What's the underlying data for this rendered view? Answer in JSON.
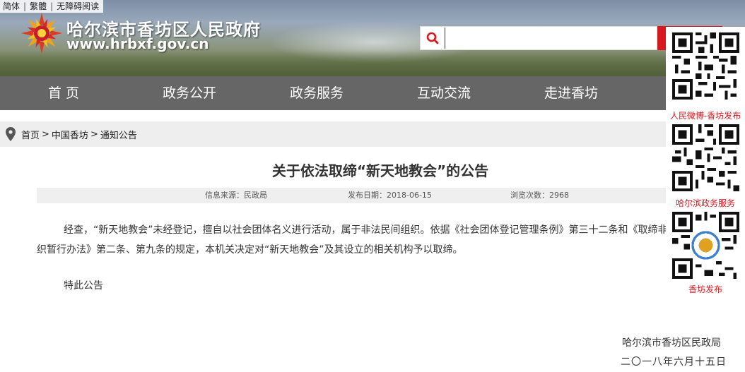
{
  "lang_bar": {
    "simplified": "简体",
    "traditional": "繁體",
    "accessibility": "无障碍阅读"
  },
  "site": {
    "title": "哈尔滨市香坊区人民政府",
    "url": "www.hrbxf.gov.cn"
  },
  "search": {
    "value": "",
    "placeholder": ""
  },
  "nav": {
    "items": [
      "首 页",
      "政务公开",
      "政务服务",
      "互动交流",
      "走进香坊"
    ]
  },
  "breadcrumb": {
    "home": "首页",
    "level1": "中国香坊",
    "current": "通知公告"
  },
  "article": {
    "title": "关于依法取缔“新天地教会”的公告",
    "source_label": "信息来源：",
    "source": "民政局",
    "date_label": "发布日期：",
    "date": "2018-06-15",
    "views_label": "浏览次数：",
    "views": "2968",
    "body": "经查，“新天地教会”未经登记，擅自以社会团体名义进行活动，属于非法民间组织。依据《社会团体登记管理条例》第三十二条和《取缔非法民间组织暂行办法》第二条、第九条的规定，本机关决定对“新天地教会”及其设立的相关机构予以取缔。",
    "note": "特此公告",
    "signer": "哈尔滨市香坊区民政局",
    "sign_date": "二〇一八年六月十五日"
  },
  "qr_codes": [
    {
      "label": "人民微博-香坊发布"
    },
    {
      "label": "哈尔滨政务服务"
    },
    {
      "label": "香坊发布"
    }
  ],
  "colors": {
    "accent": "#d7181f",
    "nav_bg": "#666666",
    "crumb_bg": "#eeeeee",
    "meta_bg": "#efefef"
  },
  "icons": {
    "search": "search-icon",
    "location": "location-pin-icon",
    "logo": "lilac-logo-icon"
  }
}
